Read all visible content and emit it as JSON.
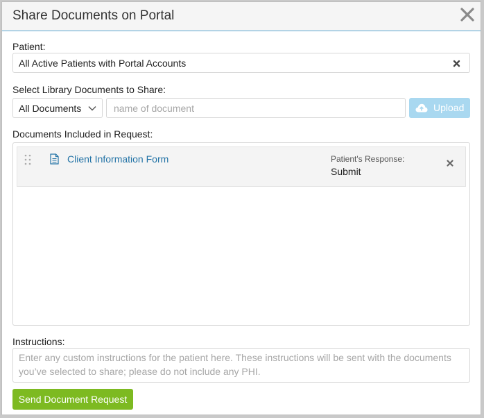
{
  "dialog": {
    "title": "Share Documents on Portal"
  },
  "patient": {
    "label": "Patient:",
    "value": "All Active Patients with Portal Accounts"
  },
  "library": {
    "label": "Select Library Documents to Share:",
    "filter_selected": "All Documents",
    "search_placeholder": "name of document",
    "upload_label": "Upload"
  },
  "documents": {
    "label": "Documents Included in Request:",
    "items": [
      {
        "name": "Client Information Form",
        "response_label": "Patient's Response:",
        "response_value": "Submit"
      }
    ]
  },
  "instructions": {
    "label": "Instructions:",
    "placeholder": "Enter any custom instructions for the patient here. These instructions will be sent with the documents you’ve selected to share; please do not include any PHI."
  },
  "actions": {
    "send_label": "Send Document Request"
  },
  "colors": {
    "header_border": "#5aa6cf",
    "link": "#2373a6",
    "upload_bg": "#a9d8f0",
    "send_bg": "#7dba21"
  },
  "icons": {
    "close": "close-icon",
    "clear": "clear-icon",
    "chevron": "chevron-down-icon",
    "upload": "cloud-upload-icon",
    "drag": "drag-handle-icon",
    "document": "document-icon",
    "remove": "remove-icon"
  }
}
